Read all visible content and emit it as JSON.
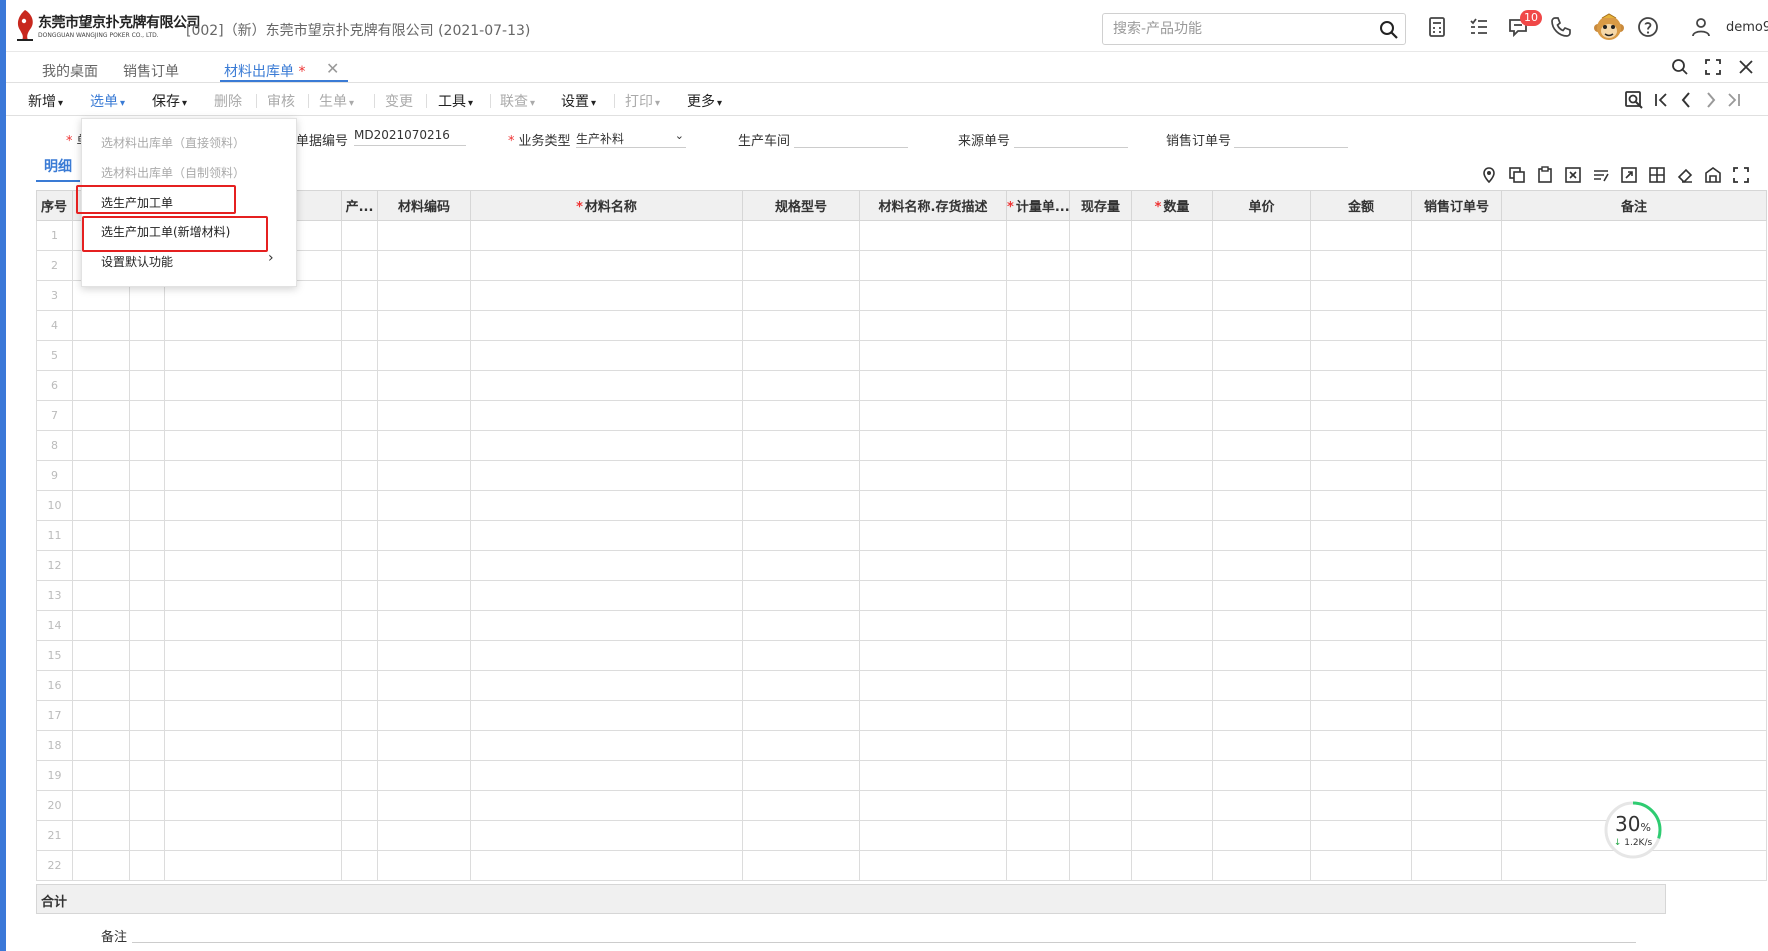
{
  "header": {
    "logo_cn": "东莞市望京扑克牌有限公司",
    "logo_en": "DONGGUAN WANGJING POKER CO., LTD.",
    "company": "[002]（新）东莞市望京扑克牌有限公司   (2021-07-13)",
    "search_placeholder": "搜索-产品功能",
    "notification_count": "10",
    "username": "demo9"
  },
  "tabs": {
    "desktop": "我的桌面",
    "sales_order": "销售订单",
    "material_out": "材料出库单",
    "required_mark": "*",
    "close": "✕"
  },
  "toolbar": {
    "new": "新增",
    "select": "选单",
    "save": "保存",
    "delete": "删除",
    "audit": "审核",
    "generate": "生单",
    "change": "变更",
    "tools": "工具",
    "query": "联查",
    "settings": "设置",
    "print": "打印",
    "more": "更多"
  },
  "form": {
    "doc_no_label": "单据编号",
    "doc_no_value": "MD2021070216",
    "biz_type_label": "业务类型",
    "biz_type_value": "生产补料",
    "workshop_label": "生产车间",
    "source_no_label": "来源单号",
    "sales_order_label": "销售订单号",
    "required_mark": "*",
    "star_label_hidden": "单"
  },
  "detail_tab": "明细",
  "table": {
    "columns": [
      "序号",
      "",
      "",
      "",
      "产...",
      "材料编码",
      "材料名称",
      "规格型号",
      "材料名称.存货描述",
      "计量单...",
      "现存量",
      "数量",
      "单价",
      "金额",
      "销售订单号",
      "备注"
    ],
    "required_columns": [
      "材料名称",
      "计量单...",
      "数量"
    ],
    "rows": [
      "1",
      "2",
      "3",
      "4",
      "5",
      "6",
      "7",
      "8",
      "9",
      "10",
      "11",
      "12",
      "13",
      "14",
      "15",
      "16",
      "17",
      "18",
      "19",
      "20",
      "21",
      "22"
    ]
  },
  "summary_label": "合计",
  "remark_label": "备注",
  "menu": {
    "items": [
      {
        "label": "选材料出库单（直接领料）",
        "disabled": true
      },
      {
        "label": "选材料出库单（自制领料）",
        "disabled": true
      },
      {
        "label": "选生产加工单",
        "disabled": false
      },
      {
        "label": "选生产加工单(新增材料)",
        "disabled": false
      },
      {
        "label": "设置默认功能",
        "disabled": false
      }
    ],
    "submenu_arrow": "›"
  },
  "speed": {
    "percent": "30",
    "percent_unit": "%",
    "rate": "1.2K/s",
    "arrow": "↓",
    "progress": 0.3
  },
  "colors": {
    "accent": "#3a7bd5",
    "highlight": "#e52020",
    "badge": "#f04848",
    "speed_ring": "#2ecc71"
  }
}
